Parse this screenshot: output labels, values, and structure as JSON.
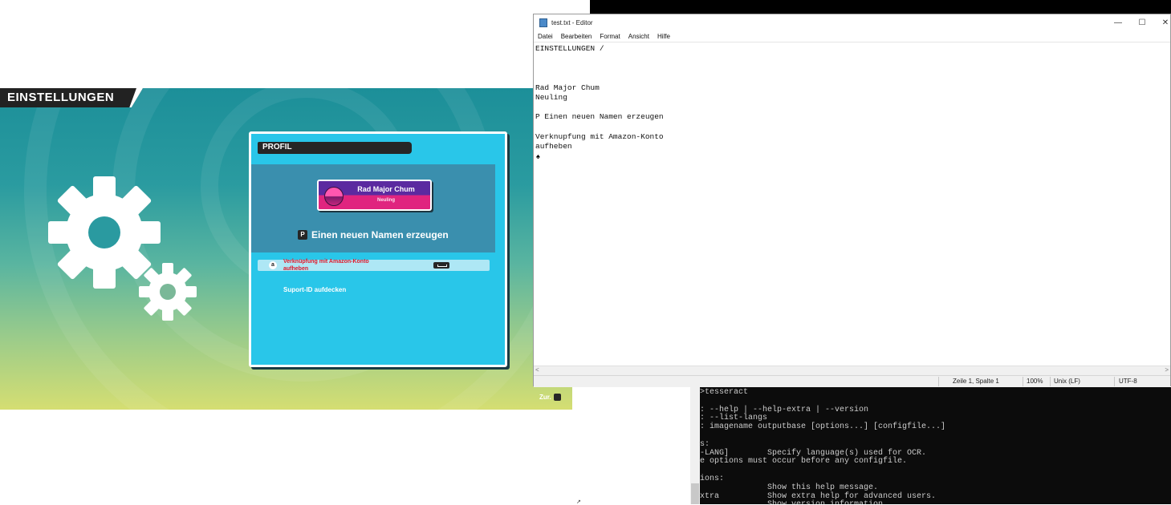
{
  "game": {
    "title": "EINSTELLUNGEN",
    "profile_tab": "PROFIL",
    "name_card": {
      "name": "Rad Major Chum",
      "rank": "Neuling"
    },
    "new_name_key": "P",
    "new_name_label": "Einen neuen Namen erzeugen",
    "amazon_icon": "a",
    "amazon_label_line1": "Verknüpfung mit Amazon-Konto",
    "amazon_label_line2": "aufheben",
    "support_label": "Suport-ID aufdecken",
    "back_label": "Zur."
  },
  "notepad": {
    "title": "test.txt - Editor",
    "window_buttons": {
      "minimize": "—",
      "maximize": "☐",
      "close": "✕"
    },
    "menu": [
      "Datei",
      "Bearbeiten",
      "Format",
      "Ansicht",
      "Hilfe"
    ],
    "text": "EINSTELLUNGEN /\n\n\n\nRad Major Chum\nNeuling\n\nP Einen neuen Namen erzeugen\n\nVerknupfung mit Amazon-Konto\naufheben",
    "caret_glyph": "♠",
    "scroll_left": "<",
    "scroll_right": ">",
    "status": {
      "position": "Zeile 1, Spalte 1",
      "zoom": "100%",
      "line_ending": "Unix (LF)",
      "encoding": "UTF-8"
    }
  },
  "terminal": {
    "text": ">tesseract\n\n: --help | --help-extra | --version\n: --list-langs\n: imagename outputbase [options...] [configfile...]\n\ns:\n-LANG]        Specify language(s) used for OCR.\ne options must occur before any configfile.\n\nions:\n              Show this help message.\nxtra          Show extra help for advanced users.\n              Show version information."
  },
  "cursor_glyph": "↗",
  "colors": {
    "panel": "#29c6e9",
    "band": "#3a8fae",
    "name_card_top": "#5b2aa0",
    "name_card_bottom": "#e0247f",
    "amazon_text": "#e0182a"
  },
  "icons": [
    "gear-icon",
    "notepad-icon",
    "amazon-icon",
    "space-key-icon",
    "back-key-icon"
  ]
}
